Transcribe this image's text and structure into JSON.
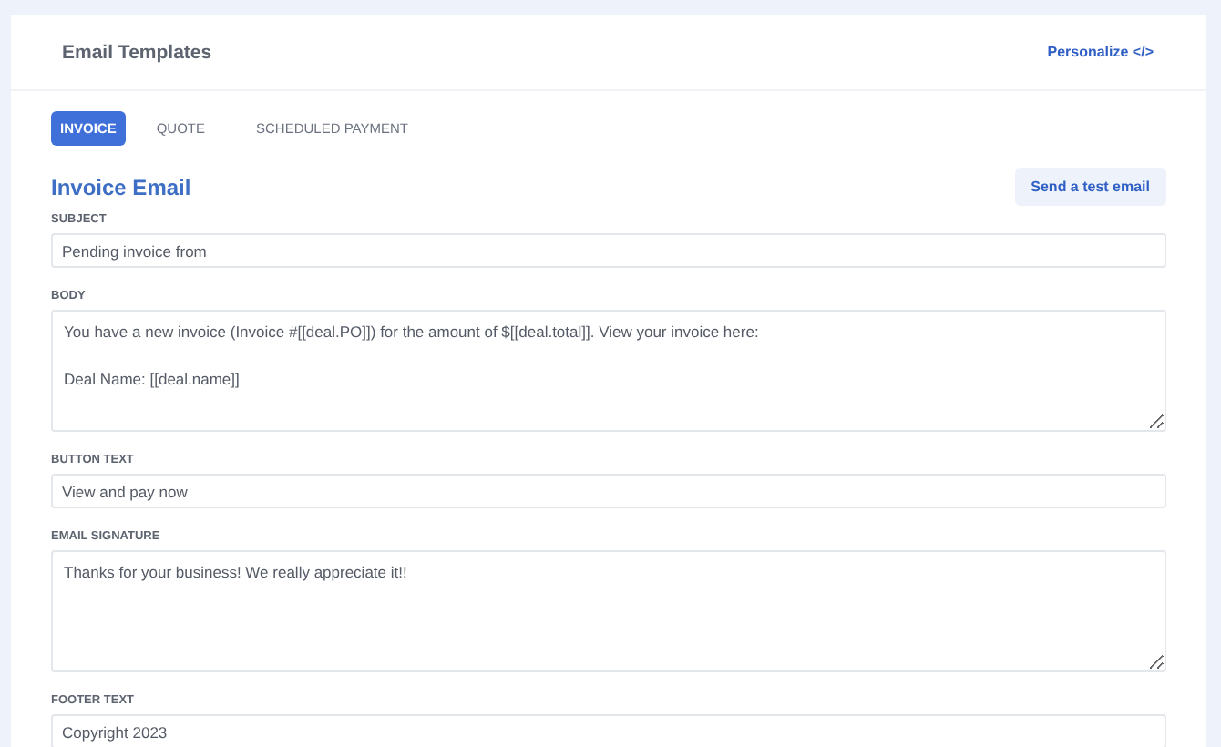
{
  "header": {
    "title": "Email Templates",
    "action": "Personalize",
    "action_icon": "</>"
  },
  "tabs": [
    {
      "label": "INVOICE",
      "selected": true
    },
    {
      "label": "QUOTE",
      "selected": false
    },
    {
      "label": "SCHEDULED PAYMENT",
      "selected": false
    }
  ],
  "section": {
    "title": "Invoice Email",
    "button": "Send a test email"
  },
  "fields": [
    {
      "label": "SUBJECT",
      "kind": "input",
      "value": "Pending invoice from"
    },
    {
      "label": "BODY",
      "kind": "textarea",
      "value": "You have a new invoice (Invoice #[[deal.PO]]) for the amount of $[[deal.total]]. View your invoice here:\n\nDeal Name: [[deal.name]]"
    },
    {
      "label": "BUTTON TEXT",
      "kind": "input",
      "value": "View and pay now"
    },
    {
      "label": "EMAIL SIGNATURE",
      "kind": "textarea",
      "value": "Thanks for your business! We really appreciate it!!"
    },
    {
      "label": "FOOTER TEXT",
      "kind": "input",
      "value": "Copyright 2023"
    }
  ]
}
